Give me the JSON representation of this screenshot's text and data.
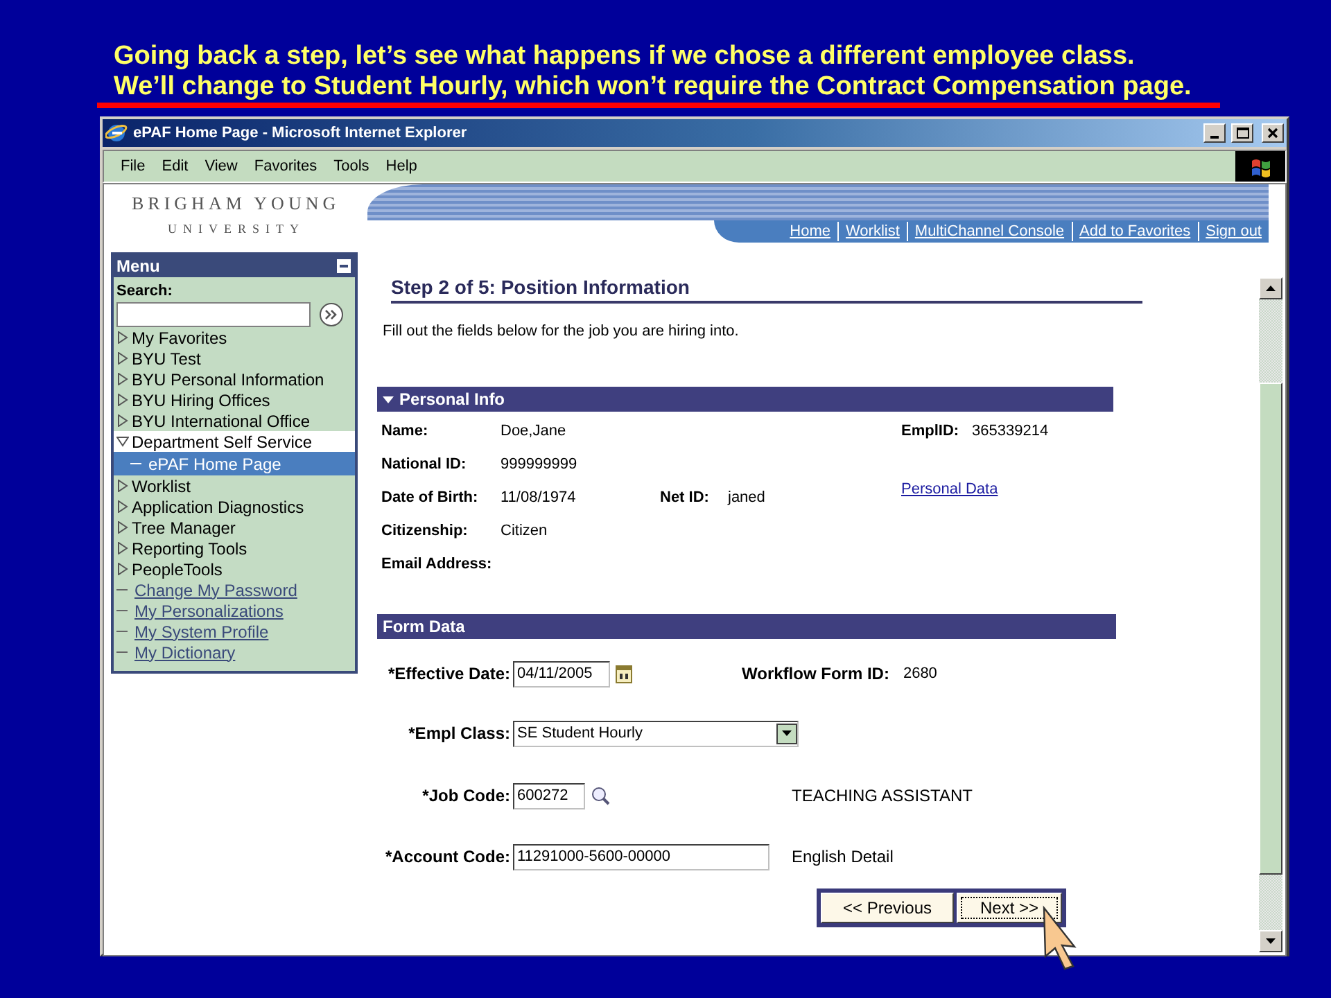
{
  "caption": "Going back a step, let’s see what happens if we chose a different employee class. We’ll change to Student Hourly, which won’t require the Contract Compensation page.",
  "window": {
    "title": "ePAF Home Page - Microsoft Internet Explorer"
  },
  "menu_bar": [
    "File",
    "Edit",
    "View",
    "Favorites",
    "Tools",
    "Help"
  ],
  "header": {
    "logo_line_1": "BRIGHAM YOUNG",
    "logo_line_2": "UNIVERSITY",
    "links": [
      "Home",
      "Worklist",
      "MultiChannel Console",
      "Add to Favorites",
      "Sign out"
    ]
  },
  "sidebar": {
    "title": "Menu",
    "search_label": "Search:",
    "items": [
      {
        "label": "My Favorites",
        "kind": "folder",
        "expanded": false,
        "selected": false
      },
      {
        "label": "BYU Test",
        "kind": "folder",
        "expanded": false,
        "selected": false
      },
      {
        "label": "BYU Personal Information",
        "kind": "folder",
        "expanded": false,
        "selected": false
      },
      {
        "label": "BYU Hiring Offices",
        "kind": "folder",
        "expanded": false,
        "selected": false
      },
      {
        "label": "BYU International Office",
        "kind": "folder",
        "expanded": false,
        "selected": false
      },
      {
        "label": "Department Self Service",
        "kind": "folder",
        "expanded": true,
        "selected": false,
        "children": [
          {
            "label": "ePAF Home Page",
            "kind": "page",
            "selected": true
          }
        ]
      },
      {
        "label": "Worklist",
        "kind": "folder",
        "expanded": false,
        "selected": false
      },
      {
        "label": "Application Diagnostics",
        "kind": "folder",
        "expanded": false,
        "selected": false
      },
      {
        "label": "Tree Manager",
        "kind": "folder",
        "expanded": false,
        "selected": false
      },
      {
        "label": "Reporting Tools",
        "kind": "folder",
        "expanded": false,
        "selected": false
      },
      {
        "label": "PeopleTools",
        "kind": "folder",
        "expanded": false,
        "selected": false
      },
      {
        "label": "Change My Password",
        "kind": "link",
        "selected": false
      },
      {
        "label": "My Personalizations",
        "kind": "link",
        "selected": false
      },
      {
        "label": "My System Profile",
        "kind": "link",
        "selected": false
      },
      {
        "label": "My Dictionary",
        "kind": "link",
        "selected": false
      }
    ]
  },
  "page": {
    "heading": "Step 2 of 5: Position Information",
    "instructions": "Fill out the fields below for the job you are hiring into.",
    "personal_info": {
      "title": "Personal Info",
      "expanded": true,
      "name": {
        "label": "Name:",
        "value": "Doe,Jane"
      },
      "empl_id": {
        "label": "EmplID:",
        "value": "365339214"
      },
      "national_id": {
        "label": "National ID:",
        "value": "999999999"
      },
      "date_of_birth": {
        "label": "Date of Birth:",
        "value": "11/08/1974"
      },
      "net_id": {
        "label": "Net ID:",
        "value": "janed"
      },
      "personal_data_link": "Personal Data",
      "citizenship": {
        "label": "Citizenship:",
        "value": "Citizen"
      },
      "email_address": {
        "label": "Email Address:"
      }
    },
    "form_data": {
      "title": "Form Data",
      "effective_date": {
        "label": "*Effective Date:",
        "value": "04/11/2005"
      },
      "workflow_form_id": {
        "label": "Workflow Form ID:",
        "value": "2680"
      },
      "empl_class": {
        "label": "*Empl Class:",
        "value": "SE Student Hourly"
      },
      "job_code": {
        "label": "*Job Code:",
        "value": "600272",
        "description": "TEACHING ASSISTANT"
      },
      "account_code": {
        "label": "*Account Code:",
        "value": "11291000-5600-00000",
        "description": "English Detail"
      }
    },
    "buttons": [
      {
        "label": "<< Previous",
        "focused": false
      },
      {
        "label": "Next >>",
        "focused": true
      }
    ]
  }
}
